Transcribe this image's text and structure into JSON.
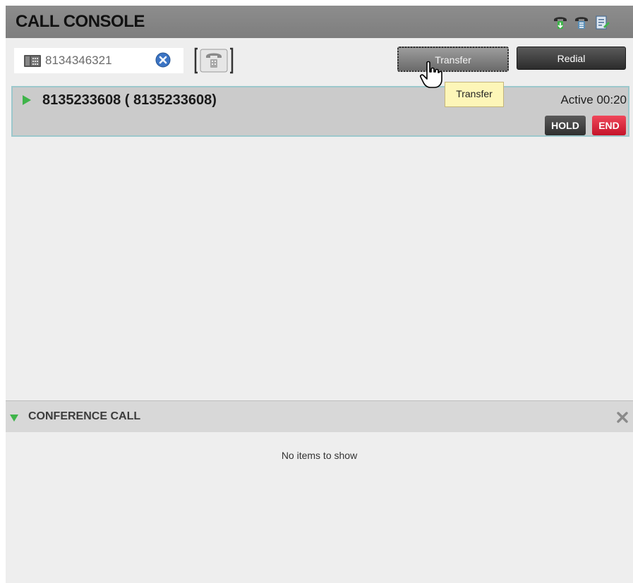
{
  "header": {
    "title": "CALL CONSOLE",
    "icons": [
      "phone-green-icon",
      "phone-transfer-icon",
      "notes-icon"
    ]
  },
  "dial": {
    "value": "8134346321",
    "clear_icon": "clear-icon",
    "dial_icon": "phone-dial-icon"
  },
  "buttons": {
    "transfer": "Transfer",
    "redial": "Redial"
  },
  "tooltip": "Transfer",
  "active_call": {
    "number": "8135233608 ( 8135233608)",
    "status": "Active 00:20",
    "hold_label": "HOLD",
    "end_label": "END"
  },
  "conference": {
    "title": "CONFERENCE CALL",
    "empty_text": "No items to show"
  },
  "colors": {
    "header_bg": "#8d8d8d",
    "end_red": "#e02a3c",
    "active_green": "#3fb44a",
    "tooltip_bg": "#fdf6b8"
  }
}
